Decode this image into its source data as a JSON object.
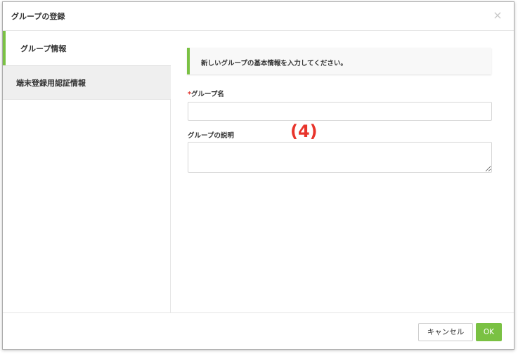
{
  "dialog": {
    "title": "グループの登録",
    "close_icon": "×"
  },
  "sidebar": {
    "items": [
      {
        "label": "グループ情報",
        "active": true
      },
      {
        "label": "端末登録用認証情報",
        "active": false
      }
    ]
  },
  "main": {
    "info_message": "新しいグループの基本情報を入力してください。",
    "fields": {
      "name": {
        "required_mark": "*",
        "label": "グループ名",
        "value": "",
        "placeholder": ""
      },
      "description": {
        "label": "グループの説明",
        "value": "",
        "placeholder": ""
      }
    },
    "annotation": "(4)"
  },
  "footer": {
    "cancel_label": "キャンセル",
    "ok_label": "OK"
  },
  "colors": {
    "accent": "#7ac143",
    "required": "#e0302a",
    "annotation": "#e8352c"
  },
  "icons": {
    "close": "close-icon"
  }
}
